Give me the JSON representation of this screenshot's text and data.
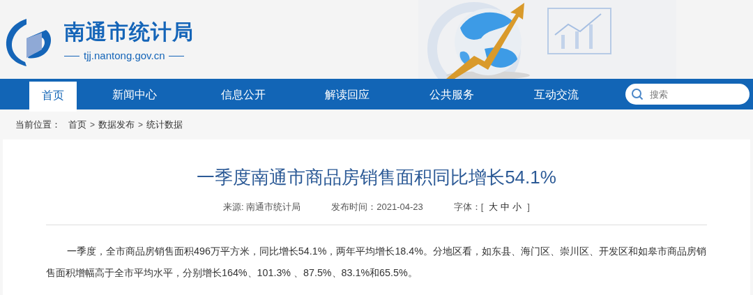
{
  "header": {
    "site_name": "南通市统计局",
    "domain": "tjj.nantong.gov.cn"
  },
  "nav": {
    "items": [
      {
        "label": "首页",
        "selected": true
      },
      {
        "label": "新闻中心",
        "selected": false
      },
      {
        "label": "信息公开",
        "selected": false
      },
      {
        "label": "解读回应",
        "selected": false
      },
      {
        "label": "公共服务",
        "selected": false
      },
      {
        "label": "互动交流",
        "selected": false
      }
    ],
    "search": {
      "placeholder": "搜索"
    }
  },
  "breadcrumb": {
    "label": "当前位置：",
    "items": [
      {
        "kind": "link",
        "text": "首页"
      },
      {
        "kind": "separator",
        "text": ">"
      },
      {
        "kind": "link",
        "text": "数据发布"
      },
      {
        "kind": "separator",
        "text": ">"
      },
      {
        "kind": "link",
        "text": "统计数据"
      }
    ]
  },
  "article": {
    "title": "一季度南通市商品房销售面积同比增长54.1%",
    "meta": {
      "source": "来源: 南通市统计局",
      "published": "发布时间：2021-04-23",
      "font_label": "字体：",
      "bracket_open": "[",
      "font_sizes": [
        "大",
        "中",
        "小"
      ],
      "bracket_close": "]"
    },
    "body": [
      "一季度，全市商品房销售面积496万平方米，同比增长54.1%，两年平均增长18.4%。分地区看，如东县、海门区、崇川区、开发区和如皋市商品房销售面积增幅高于全市平均水平，分别增长164%、101.3% 、87.5%、83.1%和65.5%。"
    ]
  }
}
